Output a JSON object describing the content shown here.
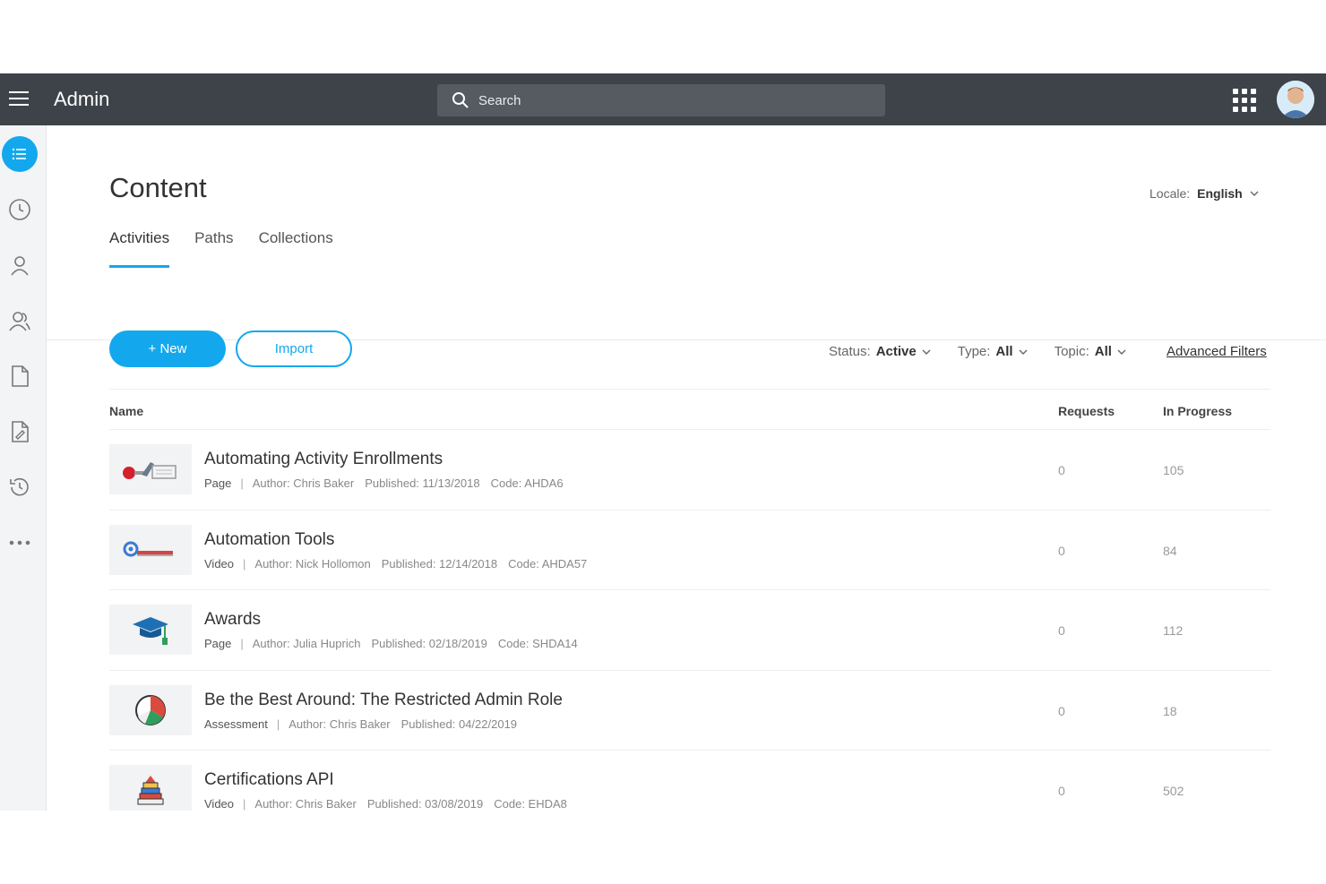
{
  "header": {
    "title": "Admin",
    "search_placeholder": "Search",
    "icons": {
      "menu": "hamburger-menu-icon",
      "search": "search-icon",
      "apps": "apps-grid-icon"
    }
  },
  "sidebar": {
    "items": [
      {
        "icon": "list-icon",
        "active": true
      },
      {
        "icon": "clock-icon",
        "active": false
      },
      {
        "icon": "user-icon",
        "active": false
      },
      {
        "icon": "users-icon",
        "active": false
      },
      {
        "icon": "document-icon",
        "active": false
      },
      {
        "icon": "document-edit-icon",
        "active": false
      },
      {
        "icon": "history-icon",
        "active": false
      },
      {
        "icon": "more-icon",
        "active": false
      }
    ]
  },
  "content": {
    "title": "Content",
    "locale": {
      "label": "Locale:",
      "value": "English"
    },
    "tabs": [
      {
        "label": "Activities",
        "active": true
      },
      {
        "label": "Paths",
        "active": false
      },
      {
        "label": "Collections",
        "active": false
      }
    ],
    "actions": {
      "new_label": "+ New",
      "import_label": "Import"
    },
    "filters": {
      "status": {
        "label": "Status:",
        "value": "Active"
      },
      "type": {
        "label": "Type:",
        "value": "All"
      },
      "topic": {
        "label": "Topic:",
        "value": "All"
      },
      "advanced_label": "Advanced Filters"
    },
    "table": {
      "columns": {
        "name": "Name",
        "requests": "Requests",
        "in_progress": "In Progress"
      },
      "rows": [
        {
          "title": "Automating Activity Enrollments",
          "type": "Page",
          "author": "Author: Chris Baker",
          "published": "Published: 11/13/2018",
          "code": "Code: AHDA6",
          "requests": "0",
          "in_progress": "105"
        },
        {
          "title": "Automation Tools",
          "type": "Video",
          "author": "Author: Nick Hollomon",
          "published": "Published: 12/14/2018",
          "code": "Code: AHDA57",
          "requests": "0",
          "in_progress": "84"
        },
        {
          "title": "Awards",
          "type": "Page",
          "author": "Author: Julia Huprich",
          "published": "Published: 02/18/2019",
          "code": "Code: SHDA14",
          "requests": "0",
          "in_progress": "112"
        },
        {
          "title": "Be the Best Around: The Restricted Admin Role",
          "type": "Assessment",
          "author": "Author: Chris Baker",
          "published": "Published: 04/22/2019",
          "code": "",
          "requests": "0",
          "in_progress": "18"
        },
        {
          "title": "Certifications API",
          "type": "Video",
          "author": "Author: Chris Baker",
          "published": "Published: 03/08/2019",
          "code": "Code: EHDA8",
          "requests": "0",
          "in_progress": "502"
        }
      ]
    }
  },
  "colors": {
    "accent": "#13a8ee",
    "topbar": "#3d4349",
    "sidebar": "#f3f4f5"
  }
}
